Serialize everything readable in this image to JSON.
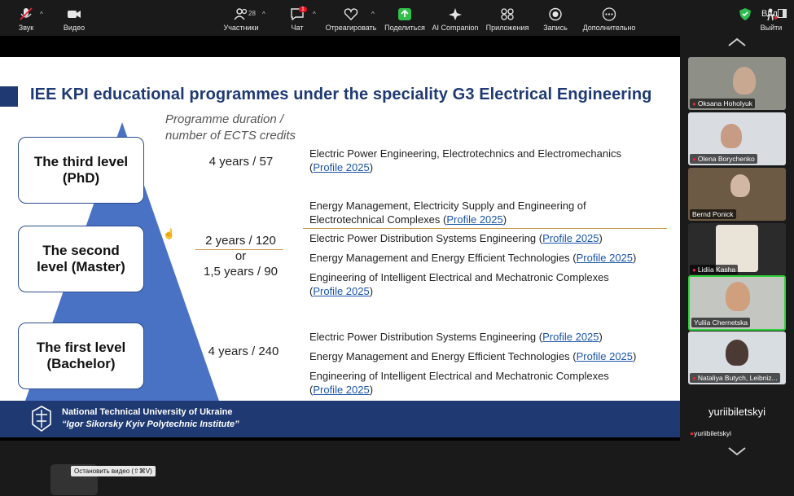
{
  "top": {
    "view_label": "Вид"
  },
  "slide": {
    "title": "IEE KPI educational programmes under the speciality G3 Electrical Engineering",
    "duration_header_line1": "Programme duration /",
    "duration_header_line2": "number of ECTS credits",
    "levels": [
      {
        "line1": "The third level",
        "line2": "(PhD)"
      },
      {
        "line1": "The second",
        "line2": "level (Master)"
      },
      {
        "line1": "The first level",
        "line2": "(Bachelor)"
      }
    ],
    "durations": {
      "phd": "4 years / 57",
      "master_a": "2 years / 120",
      "master_or": "or",
      "master_b": "1,5 years / 90",
      "bachelor": "4 years / 240"
    },
    "link_text": "Profile 2025",
    "programs": {
      "phd1": "Electric Power Engineering, Electrotechnics and Electromechanics",
      "m0a": "Energy Management, Electricity Supply and Engineering of",
      "m0b": "Electrotechnical Complexes",
      "m1": "Electric Power Distribution Systems Engineering",
      "m2": "Energy Management and Energy Efficient Technologies",
      "m3": "Engineering of Intelligent Electrical and Mechatronic Complexes",
      "b1": "Electric Power Distribution Systems Engineering",
      "b2": "Energy Management and Energy Efficient Technologies",
      "b3": "Engineering of Intelligent Electrical and Mechatronic Complexes"
    },
    "footer_line1": "National Technical University of Ukraine",
    "footer_line2": "“Igor Sikorsky Kyiv Polytechnic Institute”"
  },
  "participants": [
    {
      "name": "Oksana Hoholyuk",
      "muted": true
    },
    {
      "name": "Olena Borychenko",
      "muted": true
    },
    {
      "name": "Bernd Ponick",
      "muted": false
    },
    {
      "name": "Lidiia Kasha",
      "muted": true
    },
    {
      "name": "Yuliia Chernetska",
      "muted": false,
      "active": true
    },
    {
      "name": "Nataliya Butych, Leibniz...",
      "muted": true
    },
    {
      "name": "yuriibiletskyi",
      "muted": true,
      "display": "yuriibiletskyi"
    }
  ],
  "toolbar": {
    "sound": "Звук",
    "video": "Видео",
    "video_tooltip": "Остановить видео (⇧⌘V)",
    "participants": "Участники",
    "participants_count": "28",
    "chat": "Чат",
    "chat_badge": "1",
    "react": "Отреагировать",
    "share": "Поделиться",
    "ai": "AI Companion",
    "apps": "Приложения",
    "record": "Запись",
    "more": "Дополнительно",
    "leave": "Выйти"
  },
  "colors": {
    "navy": "#1f3a73",
    "triangle": "#4a72c4",
    "link": "#1a55a8",
    "active_border": "#2fd33a",
    "separator": "#c89a4c"
  }
}
